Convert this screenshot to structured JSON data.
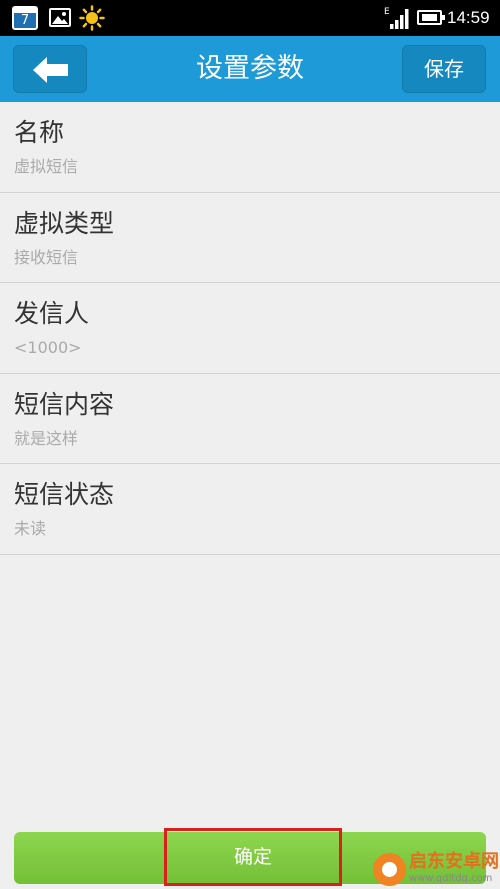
{
  "status_bar": {
    "calendar_day": "7",
    "time": "14:59",
    "network_type": "E",
    "icons": [
      "calendar-icon",
      "gallery-icon",
      "weather-sun-icon",
      "signal-icon",
      "battery-icon"
    ]
  },
  "header": {
    "title": "设置参数",
    "save_label": "保存",
    "back_icon": "back-arrow-icon"
  },
  "settings": [
    {
      "label": "名称",
      "value": "虚拟短信"
    },
    {
      "label": "虚拟类型",
      "value": "接收短信"
    },
    {
      "label": "发信人",
      "value": "<1000>"
    },
    {
      "label": "短信内容",
      "value": "就是这样"
    },
    {
      "label": "短信状态",
      "value": "未读"
    }
  ],
  "footer": {
    "confirm_label": "确定"
  },
  "watermark": {
    "name": "启东安卓网",
    "url": "www.qdltdq.com"
  },
  "colors": {
    "header": "#1d9ad7",
    "confirm": "#7ec843",
    "highlight": "#d8201d"
  }
}
